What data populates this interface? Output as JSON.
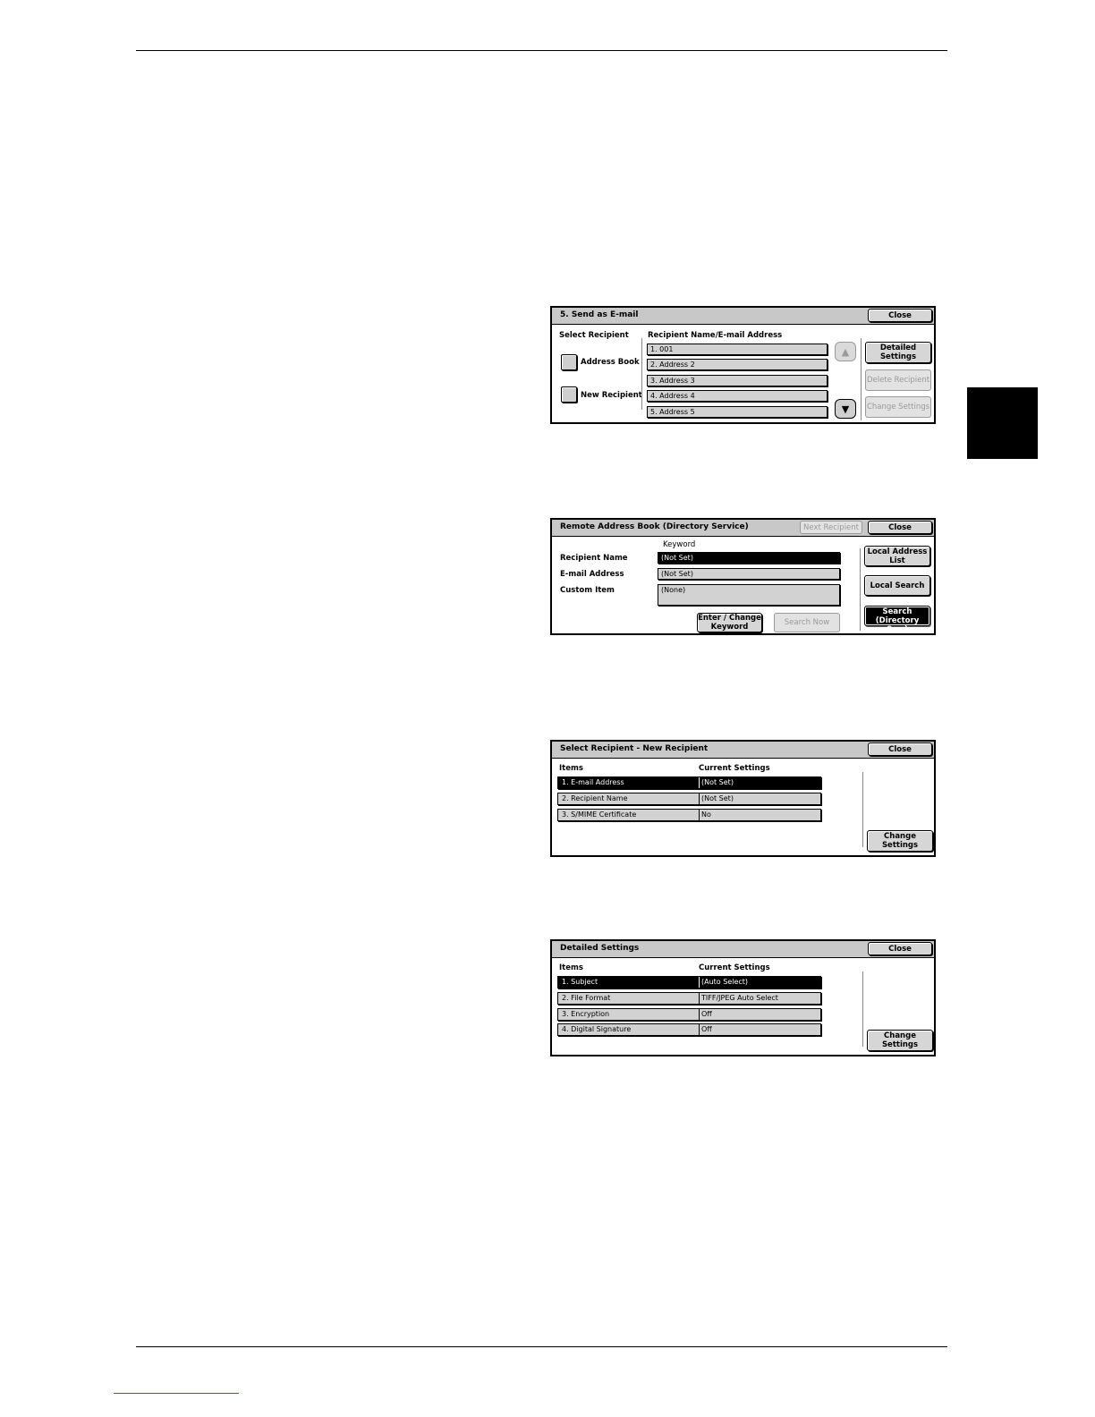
{
  "panel1": {
    "title": "5. Send as E-mail",
    "close": "Close",
    "select_recipient": "Select Recipient",
    "address_book": "Address Book",
    "new_recipient": "New Recipient",
    "list_header": "Recipient Name/E-mail Address",
    "items": [
      "1. 001",
      "2. Address 2",
      "3. Address 3",
      "4. Address 4",
      "5. Address 5"
    ],
    "detailed_settings": "Detailed Settings",
    "delete_recipient": "Delete Recipient",
    "change_settings": "Change Settings",
    "scroll_up_icon": "triangle-up",
    "scroll_down_icon": "triangle-down"
  },
  "panel2": {
    "title": "Remote Address Book (Directory Service)",
    "next_recipient": "Next Recipient",
    "close": "Close",
    "keyword": "Keyword",
    "recipient_name_label": "Recipient Name",
    "recipient_name_value": "(Not Set)",
    "email_label": "E-mail Address",
    "email_value": "(Not Set)",
    "custom_label": "Custom Item",
    "custom_value": "(None)",
    "enter_change_keyword": "Enter / Change Keyword",
    "search_now": "Search Now",
    "local_address_list": "Local Address List",
    "local_search": "Local Search",
    "remote_search": "Remote Search (Directory Svc.)"
  },
  "panel3": {
    "title": "Select Recipient - New Recipient",
    "close": "Close",
    "col_items": "Items",
    "col_current": "Current Settings",
    "rows": [
      {
        "item": "1. E-mail Address",
        "value": "(Not Set)"
      },
      {
        "item": "2. Recipient Name",
        "value": "(Not Set)"
      },
      {
        "item": "3. S/MIME Certificate",
        "value": "No"
      }
    ],
    "change_settings": "Change Settings"
  },
  "panel4": {
    "title": "Detailed Settings",
    "close": "Close",
    "col_items": "Items",
    "col_current": "Current Settings",
    "rows": [
      {
        "item": "1. Subject",
        "value": "(Auto Select)"
      },
      {
        "item": "2. File Format",
        "value": "TIFF/JPEG Auto Select"
      },
      {
        "item": "3. Encryption",
        "value": "Off"
      },
      {
        "item": "4. Digital Signature",
        "value": "Off"
      }
    ],
    "change_settings": "Change Settings"
  }
}
